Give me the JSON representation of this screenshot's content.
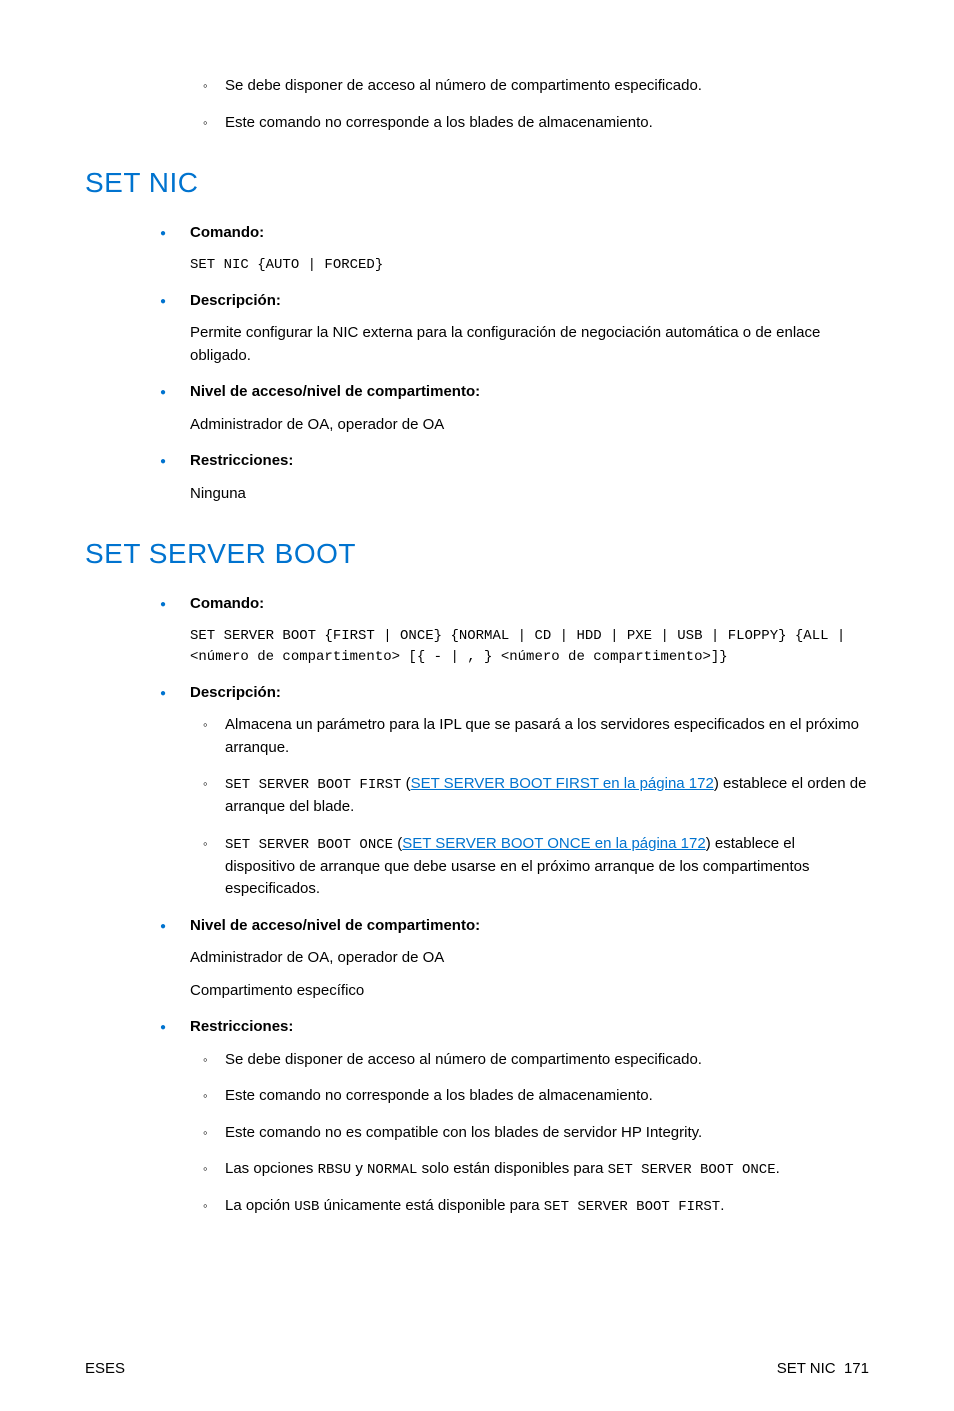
{
  "intro_sublist": [
    "Se debe disponer de acceso al número de compartimento especificado.",
    "Este comando no corresponde a los blades de almacenamiento."
  ],
  "section1": {
    "heading": "SET NIC",
    "items": {
      "comando": {
        "label": "Comando:",
        "code": "SET NIC {AUTO | FORCED}"
      },
      "descripcion": {
        "label": "Descripción:",
        "text": "Permite configurar la NIC externa para la configuración de negociación automática o de enlace obligado."
      },
      "nivel": {
        "label": "Nivel de acceso/nivel de compartimento:",
        "text": "Administrador de OA, operador de OA"
      },
      "restricciones": {
        "label": "Restricciones:",
        "text": "Ninguna"
      }
    }
  },
  "section2": {
    "heading": "SET SERVER BOOT",
    "items": {
      "comando": {
        "label": "Comando:",
        "code": "SET SERVER BOOT {FIRST | ONCE} {NORMAL | CD | HDD | PXE | USB | FLOPPY} {ALL | <número de compartimento> [{ - | , } <número de compartimento>]}"
      },
      "descripcion": {
        "label": "Descripción:",
        "sub": {
          "a": "Almacena un parámetro para la IPL que se pasará a los servidores especificados en el próximo arranque.",
          "b_code": "SET SERVER BOOT FIRST",
          "b_paren_open": " (",
          "b_link": "SET SERVER BOOT FIRST en la página 172",
          "b_paren_close": ") ",
          "b_tail": "establece el orden de arranque del blade.",
          "c_code": "SET SERVER BOOT ONCE",
          "c_paren_open": " (",
          "c_link": "SET SERVER BOOT ONCE en la página 172",
          "c_paren_close": ") ",
          "c_tail": "establece el dispositivo de arranque que debe usarse en el próximo arranque de los compartimentos especificados."
        }
      },
      "nivel": {
        "label": "Nivel de acceso/nivel de compartimento:",
        "text1": "Administrador de OA, operador de OA",
        "text2": "Compartimento específico"
      },
      "restricciones": {
        "label": "Restricciones:",
        "sub": {
          "a": "Se debe disponer de acceso al número de compartimento especificado.",
          "b": "Este comando no corresponde a los blades de almacenamiento.",
          "c": "Este comando no es compatible con los blades de servidor HP Integrity.",
          "d_pre": "Las opciones ",
          "d_code1": "RBSU",
          "d_mid": " y ",
          "d_code2": "NORMAL",
          "d_mid2": " solo están disponibles para ",
          "d_code3": "SET SERVER BOOT ONCE",
          "d_post": ".",
          "e_pre": "La opción ",
          "e_code1": "USB",
          "e_mid": " únicamente está disponible para ",
          "e_code2": "SET SERVER BOOT FIRST",
          "e_post": "."
        }
      }
    }
  },
  "footer": {
    "left": "ESES",
    "right_label": "SET NIC",
    "right_page": "171"
  }
}
